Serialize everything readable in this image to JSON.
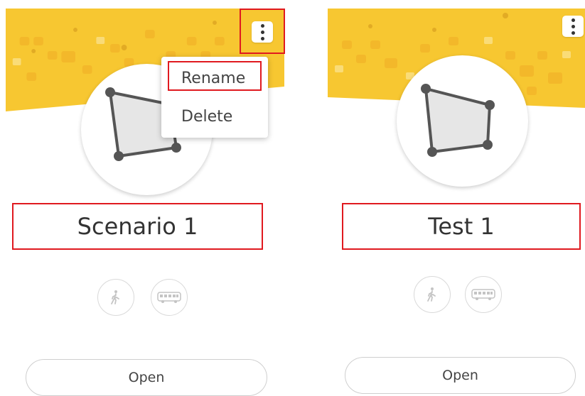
{
  "cards": [
    {
      "title": "Scenario 1",
      "open_label": "Open",
      "menu": {
        "rename_label": "Rename",
        "delete_label": "Delete"
      },
      "modes": [
        "walk-icon",
        "bus-icon"
      ]
    },
    {
      "title": "Test 1",
      "open_label": "Open",
      "modes": [
        "walk-icon",
        "bus-icon"
      ]
    }
  ],
  "colors": {
    "banner": "#f7c731",
    "highlight": "#e0191f",
    "polygon_fill": "#e6e6e6",
    "polygon_stroke": "#555555"
  }
}
